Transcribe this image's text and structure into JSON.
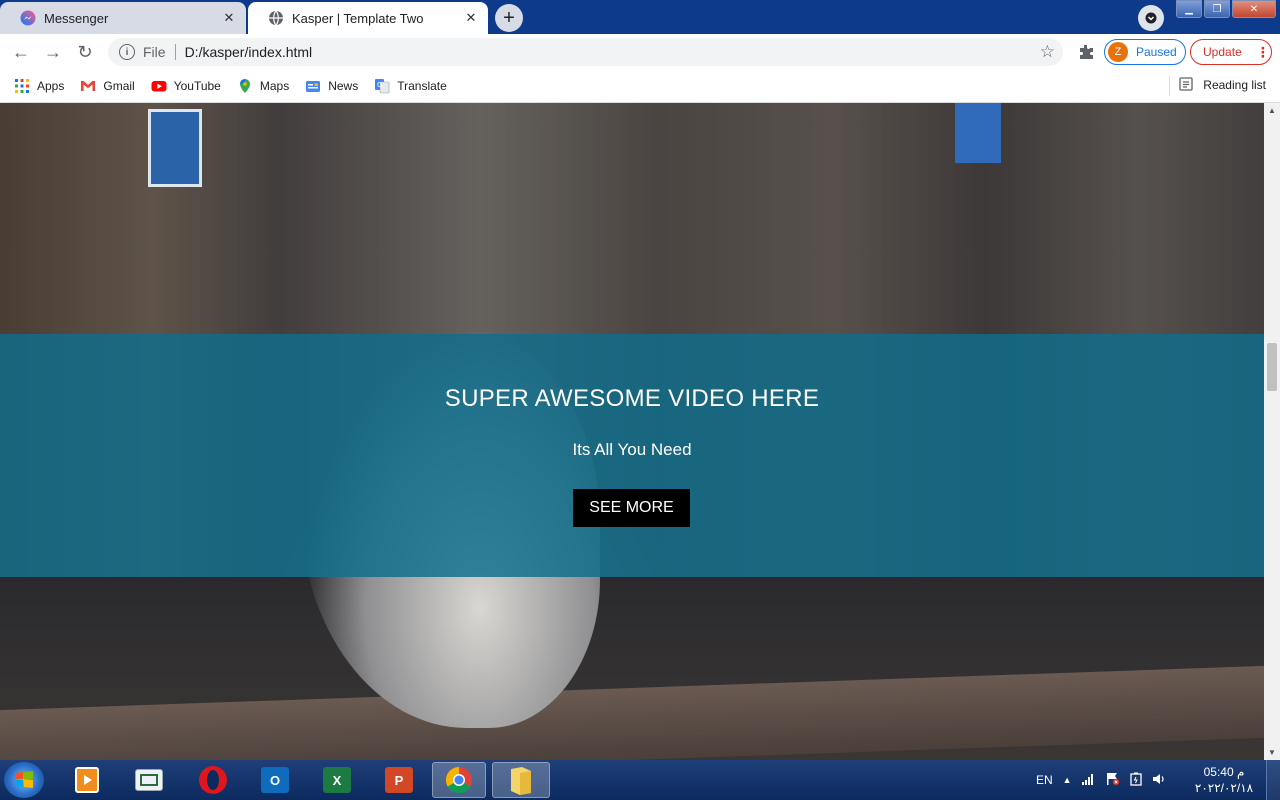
{
  "browser": {
    "tabs": [
      {
        "title": "Messenger",
        "active": false,
        "icon": "messenger-icon"
      },
      {
        "title": "Kasper | Template Two",
        "active": true,
        "icon": "globe-icon"
      }
    ],
    "new_tab_label": "+",
    "close_label": "✕",
    "address": {
      "scheme_label": "File",
      "url": "D:/kasper/index.html"
    },
    "profile": {
      "initial": "Z",
      "status": "Paused"
    },
    "update_label": "Update",
    "bookmarks": [
      {
        "label": "Apps",
        "icon": "apps-grid-icon"
      },
      {
        "label": "Gmail",
        "icon": "gmail-icon"
      },
      {
        "label": "YouTube",
        "icon": "youtube-icon"
      },
      {
        "label": "Maps",
        "icon": "maps-pin-icon"
      },
      {
        "label": "News",
        "icon": "news-icon"
      },
      {
        "label": "Translate",
        "icon": "translate-icon"
      }
    ],
    "reading_list_label": "Reading list"
  },
  "page": {
    "video_title": "SUPER AWESOME VIDEO HERE",
    "video_subtitle": "Its All You Need",
    "cta_label": "SEE MORE",
    "band_color": "#0d6e8c"
  },
  "taskbar": {
    "apps": [
      {
        "name": "media-player-icon",
        "active": false
      },
      {
        "name": "screen-icon",
        "active": false
      },
      {
        "name": "opera-icon",
        "active": false
      },
      {
        "name": "outlook-icon",
        "active": false,
        "letter": "O"
      },
      {
        "name": "excel-icon",
        "active": false,
        "letter": "X"
      },
      {
        "name": "powerpoint-icon",
        "active": false,
        "letter": "P"
      },
      {
        "name": "chrome-icon",
        "active": true
      },
      {
        "name": "folder-icon",
        "active": true
      }
    ],
    "language": "EN",
    "time": "05:40 م",
    "date": "٢٠٢٢/٠٢/١٨"
  }
}
